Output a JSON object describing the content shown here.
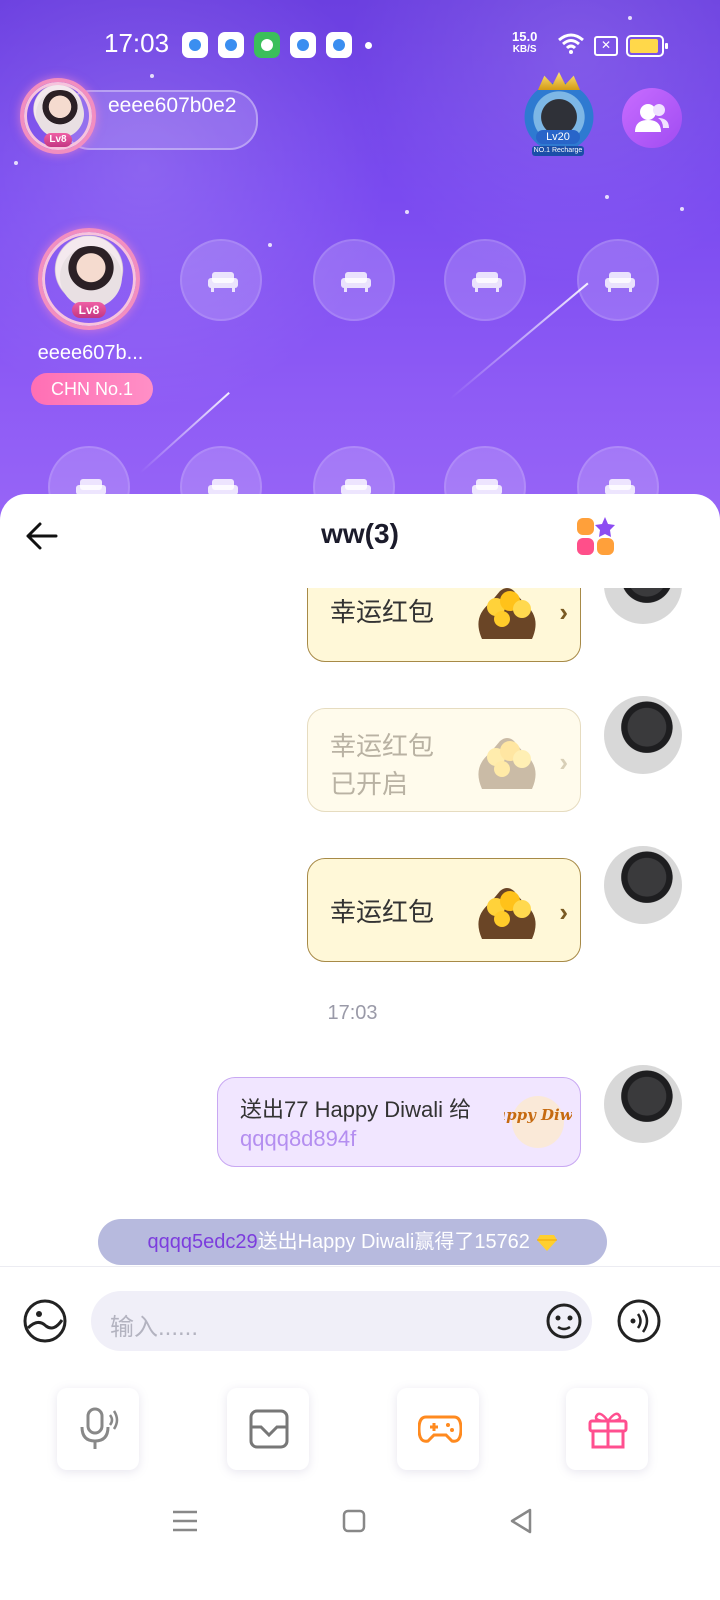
{
  "status_bar": {
    "time": "17:03",
    "net_speed_value": "15.0",
    "net_speed_unit": "KB/S",
    "battery_color": "#ffd84a"
  },
  "room": {
    "host_name": "eeee607b0e2",
    "host_level": "Lv8",
    "rank_level": "Lv20",
    "rank_caption": "NO.1 Recharge",
    "seat_host_name": "eeee607b...",
    "seat_host_level": "Lv8",
    "seat_host_tag": "CHN No.1",
    "empty_seat_icon": "sofa-icon"
  },
  "chat": {
    "title": "ww(3)",
    "messages": [
      {
        "type": "red-packet",
        "label": "幸运红包",
        "opened": false
      },
      {
        "type": "red-packet",
        "label_line1": "幸运红包",
        "label_line2": "已开启",
        "opened": true
      },
      {
        "type": "red-packet",
        "label": "幸运红包",
        "opened": false
      },
      {
        "type": "timestamp",
        "text": "17:03"
      },
      {
        "type": "gift",
        "line1": "送出77 Happy Diwali 给",
        "line2": "qqqq8d894f",
        "gift_art_text": "Happy Diwali"
      }
    ],
    "system_message": {
      "user": "qqqq5edc29",
      "text": "送出Happy Diwali赢得了15762"
    }
  },
  "input": {
    "placeholder": "输入......"
  },
  "tools": [
    "mic-icon",
    "inbox-icon",
    "gamepad-icon",
    "gift-icon"
  ],
  "colors": {
    "accent": "#7a4af0",
    "tag_pink": "#ff6fb4",
    "red_packet_bg": "#fff8d8",
    "gift_bubble_bg": "#f1e6ff"
  }
}
